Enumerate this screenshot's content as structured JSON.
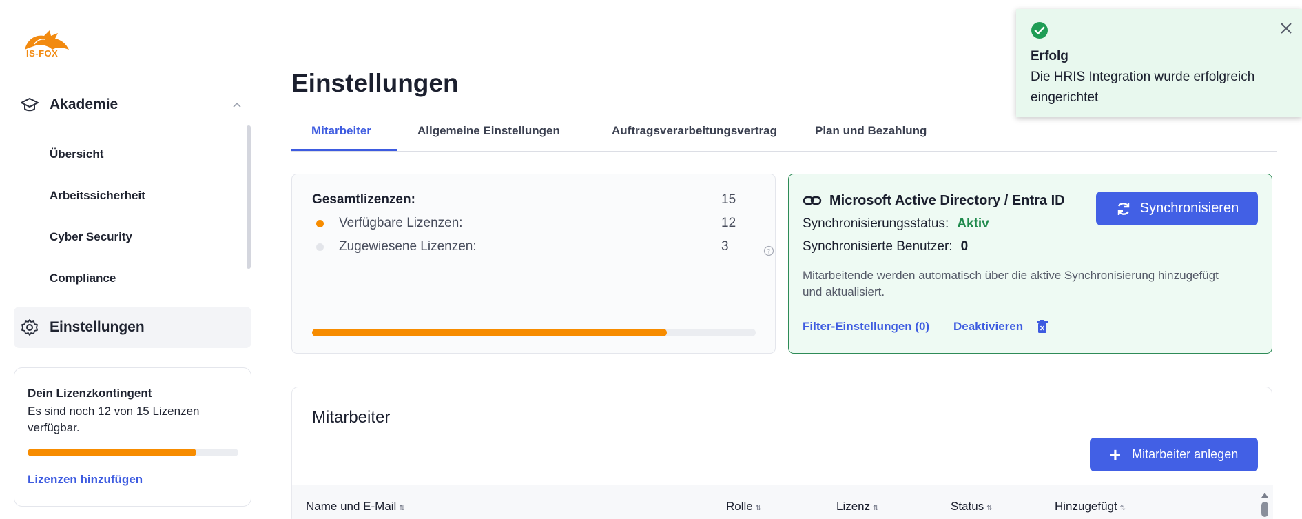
{
  "sidebar": {
    "logo_text": "IS-FOX",
    "group": {
      "label": "Akademie",
      "icon": "graduation-cap-icon"
    },
    "sub_items": [
      {
        "label": "Übersicht"
      },
      {
        "label": "Arbeitssicherheit"
      },
      {
        "label": "Cyber Security"
      },
      {
        "label": "Compliance"
      }
    ],
    "active_item": {
      "label": "Einstellungen",
      "icon": "gear-icon"
    },
    "license_card": {
      "title": "Dein Lizenzkontingent",
      "description": "Es sind noch 12 von 15 Lizenzen verfügbar.",
      "progress_fraction": 0.8,
      "link": "Lizenzen hinzufügen"
    }
  },
  "main": {
    "title": "Einstellungen",
    "tabs": [
      {
        "label": "Mitarbeiter",
        "active": true
      },
      {
        "label": "Allgemeine Einstellungen",
        "active": false
      },
      {
        "label": "Auftragsverarbeitungsvertrag",
        "active": false
      },
      {
        "label": "Plan und Bezahlung",
        "active": false
      }
    ],
    "licenses": {
      "total_label": "Gesamtlizenzen:",
      "total_value": "15",
      "available_label": "Verfügbare Lizenzen:",
      "available_value": "12",
      "assigned_label": "Zugewiesene Lizenzen:",
      "assigned_value": "3",
      "progress_fraction": 0.8
    },
    "hris": {
      "title": "Microsoft Active Directory / Entra ID",
      "sync_button": "Synchronisieren",
      "status_label": "Synchronisierungsstatus:",
      "status_value": "Aktiv",
      "users_label": "Synchronisierte Benutzer:",
      "users_value": "0",
      "description": "Mitarbeitende werden automatisch über die aktive Synchronisierung hinzugefügt und aktualisiert.",
      "filter_link": "Filter-Einstellungen (0)",
      "deactivate_link": "Deaktivieren"
    },
    "employees": {
      "title": "Mitarbeiter",
      "add_button": "Mitarbeiter anlegen",
      "columns": [
        "Name und E-Mail",
        "Rolle",
        "Lizenz",
        "Status",
        "Hinzugefügt"
      ]
    }
  },
  "toast": {
    "title": "Erfolg",
    "message": "Die HRIS Integration wurde erfolgreich eingerichtet"
  },
  "colors": {
    "accent": "#4260e5",
    "orange": "#f78c00",
    "success": "#1f8a4c"
  }
}
